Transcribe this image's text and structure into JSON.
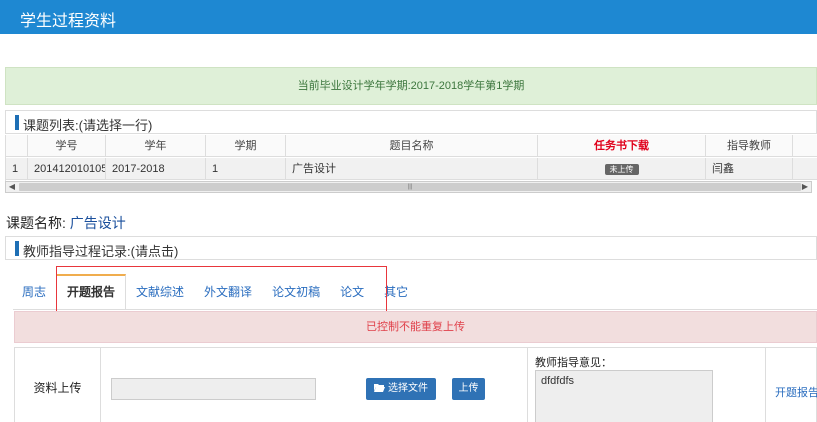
{
  "header": {
    "title": "学生过程资料"
  },
  "semester_info": "当前毕业设计学年学期:2017-2018学年第1学期",
  "course_list": {
    "title": "课题列表:(请选择一行)",
    "columns": [
      "",
      "学号",
      "学年",
      "学期",
      "题目名称",
      "任务书下载",
      "指导教师",
      ""
    ],
    "rows": [
      {
        "index": "1",
        "student_id": "201412010105",
        "year": "2017-2018",
        "term": "1",
        "topic": "广告设计",
        "task_status": "未上传",
        "teacher": "闫鑫"
      }
    ]
  },
  "course_name": {
    "label": "课题名称: ",
    "value": "广告设计"
  },
  "guidance": {
    "title": "教师指导过程记录:(请点击)",
    "tabs": [
      "周志",
      "开题报告",
      "文献综述",
      "外文翻译",
      "论文初稿",
      "论文",
      "其它"
    ],
    "active_tab": "开题报告"
  },
  "alert": "已控制不能重复上传",
  "upload": {
    "label": "资料上传",
    "choose_file": "选择文件",
    "upload_button": "上传",
    "comment_label": "教师指导意见：",
    "comment_text": "dfdfdfs",
    "report_link": "开题报告.c"
  },
  "icons": {
    "folder": "folder-open-icon"
  },
  "colors": {
    "header": "#1e88d2",
    "button": "#2f72b5",
    "highlight_box": "#e8363c",
    "alert_text": "#e0404a"
  }
}
